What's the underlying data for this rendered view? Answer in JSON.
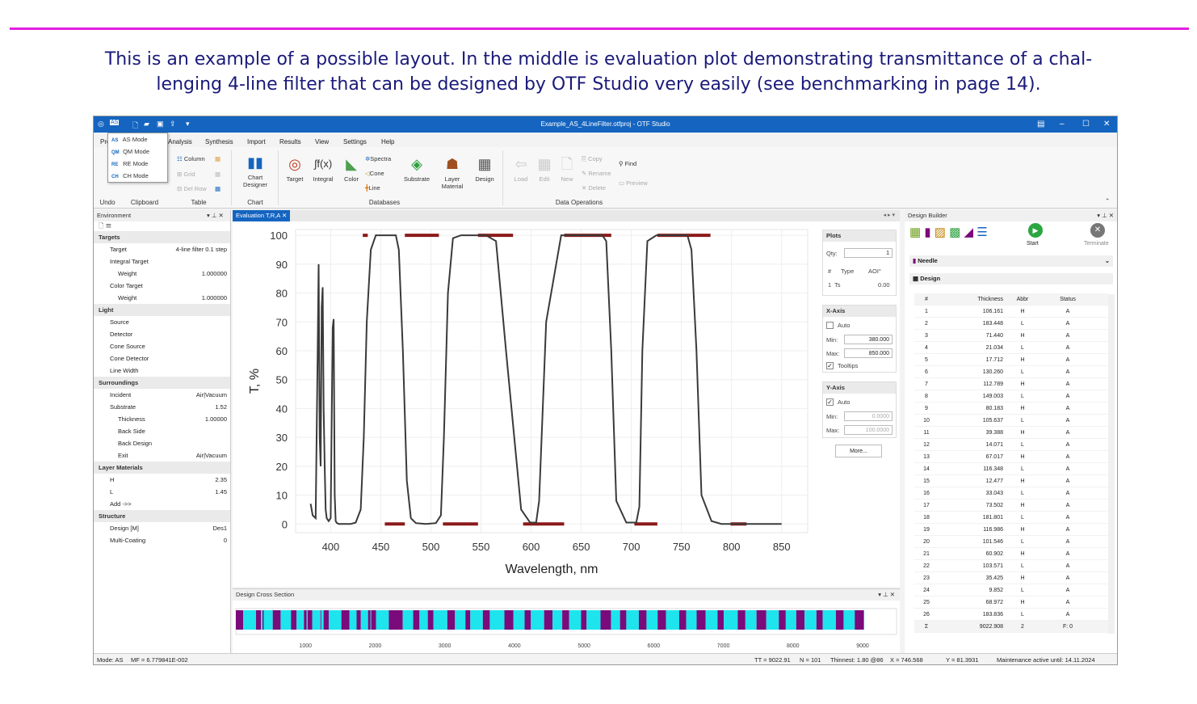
{
  "caption": {
    "line1": "This is an example of a possible layout. In the middle is evaluation plot demonstrating transmittance of a chal-",
    "line2": "lenging 4-line filter that can be designed by OTF Studio very easily (see benchmarking in page 14)."
  },
  "window": {
    "title": "Example_AS_4LineFilter.otfproj - OTF Studio",
    "mode_badge": "AS"
  },
  "menu": [
    "Pro",
    "Analysis",
    "Synthesis",
    "Import",
    "Results",
    "View",
    "Settings",
    "Help"
  ],
  "mode_menu": [
    {
      "code": "AS",
      "label": "AS Mode"
    },
    {
      "code": "QM",
      "label": "QM Mode"
    },
    {
      "code": "RE",
      "label": "RE Mode"
    },
    {
      "code": "CH",
      "label": "CH Mode"
    }
  ],
  "ribbon": {
    "table_items": [
      "Column",
      "Grid",
      "Del Row"
    ],
    "chart_designer": "Chart Designer",
    "db_buttons": [
      "Target",
      "Integral",
      "Color"
    ],
    "db_small": [
      "Spectra",
      "Cone",
      "Line"
    ],
    "substrate": "Substrate",
    "layer_material": "Layer Material",
    "design": "Design",
    "dataops": [
      "Load",
      "Edit",
      "New"
    ],
    "dataops_small": [
      "Copy",
      "Rename",
      "Delete"
    ],
    "find": "Find",
    "preview": "Preview",
    "groups": [
      "Undo",
      "Clipboard",
      "Table",
      "Chart",
      "Databases",
      "Data Operations"
    ]
  },
  "env": {
    "title": "Environment",
    "rows": [
      {
        "t": "cat",
        "label": "Targets"
      },
      {
        "t": "in1",
        "label": "Target",
        "value": "4-line filter 0.1 step"
      },
      {
        "t": "in1",
        "label": "Integral Target",
        "value": ""
      },
      {
        "t": "in2",
        "label": "Weight",
        "value": "1.000000"
      },
      {
        "t": "in1",
        "label": "Color Target",
        "value": ""
      },
      {
        "t": "in2",
        "label": "Weight",
        "value": "1.000000"
      },
      {
        "t": "cat",
        "label": "Light"
      },
      {
        "t": "in1",
        "label": "Source",
        "value": ""
      },
      {
        "t": "in1",
        "label": "Detector",
        "value": ""
      },
      {
        "t": "in1",
        "label": "Cone Source",
        "value": ""
      },
      {
        "t": "in1",
        "label": "Cone Detector",
        "value": ""
      },
      {
        "t": "in1",
        "label": "Line Width",
        "value": ""
      },
      {
        "t": "cat",
        "label": "Surroundings"
      },
      {
        "t": "in1",
        "label": "Incident",
        "value": "Air|Vacuum"
      },
      {
        "t": "in1",
        "label": "Substrate",
        "value": "1.52"
      },
      {
        "t": "in2",
        "label": "Thickness",
        "value": "1.00000"
      },
      {
        "t": "in2",
        "label": "Back Side",
        "value": ""
      },
      {
        "t": "in2",
        "label": "Back Design",
        "value": ""
      },
      {
        "t": "in2",
        "label": "Exit",
        "value": "Air|Vacuum"
      },
      {
        "t": "cat",
        "label": "Layer Materials"
      },
      {
        "t": "in1",
        "label": "H",
        "value": "2.35"
      },
      {
        "t": "in1",
        "label": "L",
        "value": "1.45"
      },
      {
        "t": "in1",
        "label": "Add ->>",
        "value": ""
      },
      {
        "t": "cat",
        "label": "Structure"
      },
      {
        "t": "in1",
        "label": "Design [M]",
        "value": "Des1"
      },
      {
        "t": "in1",
        "label": "Multi-Coating",
        "value": "0"
      }
    ]
  },
  "plot_tab": "Evaluation T,R,A",
  "chart_data": {
    "type": "line",
    "xlabel": "Wavelength, nm",
    "ylabel": "T, %",
    "xticks": [
      400,
      450,
      500,
      550,
      600,
      650,
      700,
      750,
      800,
      850
    ],
    "yticks": [
      0,
      10,
      20,
      30,
      40,
      50,
      60,
      70,
      80,
      90,
      100
    ],
    "xlim": [
      365,
      876
    ],
    "ylim": [
      -3,
      102
    ],
    "series": [
      {
        "x": [
          380,
          382,
          385,
          387,
          388,
          389,
          390,
          391,
          392,
          393,
          394,
          395,
          396,
          398,
          400,
          402,
          403,
          404,
          405,
          406,
          408,
          410,
          412,
          420,
          425,
          430,
          433,
          436,
          440,
          445,
          450,
          455,
          460,
          465,
          468,
          472,
          476,
          480,
          485,
          495,
          505,
          510,
          513,
          517,
          522,
          530,
          535,
          540,
          545,
          555,
          565,
          575,
          590,
          599,
          602,
          605,
          608,
          615,
          630,
          655,
          668,
          671,
          675,
          680,
          685,
          695,
          705,
          708,
          711,
          716,
          725,
          740,
          752,
          756,
          760,
          765,
          770,
          780,
          790,
          800,
          820,
          850
        ],
        "y": [
          7,
          3,
          2,
          60,
          90,
          30,
          20,
          75,
          82,
          40,
          20,
          5,
          2,
          1,
          2,
          68,
          71,
          10,
          1,
          0.4,
          0,
          0,
          0,
          0,
          0.5,
          5,
          30,
          70,
          95,
          100,
          100,
          100,
          100,
          100,
          95,
          60,
          15,
          2,
          0.3,
          0,
          0.3,
          3,
          30,
          80,
          99,
          100,
          100,
          100,
          100,
          100,
          98,
          60,
          5,
          0.5,
          0.5,
          0.5,
          8,
          70,
          100,
          100,
          100,
          100,
          98,
          60,
          8,
          0.5,
          0.5,
          6,
          60,
          98,
          100,
          100,
          100,
          100,
          95,
          60,
          10,
          1,
          0,
          0,
          0,
          0
        ]
      }
    ],
    "targets": [
      [
        432,
        437,
        100
      ],
      [
        454,
        474,
        0
      ],
      [
        474,
        508,
        100
      ],
      [
        512,
        547,
        0
      ],
      [
        547,
        582,
        100
      ],
      [
        592,
        633,
        0
      ],
      [
        633,
        680,
        100
      ],
      [
        703,
        726,
        0
      ],
      [
        726,
        779,
        100
      ],
      [
        799,
        815,
        0
      ]
    ]
  },
  "props": {
    "plots": "Plots",
    "qty_label": "Qty:",
    "qty": "1",
    "col_num": "#",
    "col_type": "Type",
    "col_aoi": "AOI°",
    "row_num": "1",
    "row_type": "Ts",
    "row_aoi": "0.00",
    "xaxis": "X-Axis",
    "auto": "Auto",
    "min_label": "Min:",
    "max_label": "Max:",
    "xmin": "380.000",
    "xmax": "850.000",
    "tooltips": "Tooltips",
    "yaxis": "Y-Axis",
    "ymin": "0.0000",
    "ymax": "100.0000",
    "more": "More..."
  },
  "cross": {
    "title": "Design Cross Section",
    "ticks": [
      1000,
      2000,
      3000,
      4000,
      5000,
      6000,
      7000,
      8000,
      9000
    ],
    "total": 9022.908,
    "layers": [
      106.161,
      183.448,
      71.44,
      21.034,
      17.712,
      130.26,
      112.789,
      149.003,
      80.183,
      105.637,
      39.388,
      14.071,
      67.017,
      116.348,
      12.477,
      33.043,
      73.502,
      181.801,
      116.986,
      101.546,
      60.902,
      103.571,
      35.425,
      9.852,
      68.972,
      183.836,
      200,
      150,
      90,
      120,
      80,
      200,
      110,
      150,
      70,
      180,
      100,
      210,
      130,
      160,
      90,
      190,
      120,
      140,
      100,
      170,
      80,
      200,
      150,
      130,
      90,
      180,
      110,
      160,
      120,
      190,
      100,
      150,
      130,
      170,
      90,
      200,
      110,
      160,
      140,
      180,
      100,
      150,
      120,
      170,
      90,
      190,
      110,
      160,
      130,
      180,
      100,
      150,
      120,
      170,
      90,
      200,
      110,
      160,
      140,
      180,
      100,
      150,
      120,
      170,
      90,
      190,
      110,
      160,
      130,
      180,
      100,
      120
    ]
  },
  "designbuilder": {
    "title": "Design Builder",
    "start": "Start",
    "terminate": "Terminate",
    "needle": "Needle",
    "design": "Design",
    "headers": [
      "#",
      "Thickness",
      "Abbr",
      "Status"
    ],
    "rows": [
      [
        "1",
        "106.161",
        "H",
        "A"
      ],
      [
        "2",
        "183.448",
        "L",
        "A"
      ],
      [
        "3",
        "71.440",
        "H",
        "A"
      ],
      [
        "4",
        "21.034",
        "L",
        "A"
      ],
      [
        "5",
        "17.712",
        "H",
        "A"
      ],
      [
        "6",
        "130.260",
        "L",
        "A"
      ],
      [
        "7",
        "112.789",
        "H",
        "A"
      ],
      [
        "8",
        "149.003",
        "L",
        "A"
      ],
      [
        "9",
        "80.183",
        "H",
        "A"
      ],
      [
        "10",
        "105.637",
        "L",
        "A"
      ],
      [
        "11",
        "39.388",
        "H",
        "A"
      ],
      [
        "12",
        "14.071",
        "L",
        "A"
      ],
      [
        "13",
        "67.017",
        "H",
        "A"
      ],
      [
        "14",
        "116.348",
        "L",
        "A"
      ],
      [
        "15",
        "12.477",
        "H",
        "A"
      ],
      [
        "16",
        "33.043",
        "L",
        "A"
      ],
      [
        "17",
        "73.502",
        "H",
        "A"
      ],
      [
        "18",
        "181.801",
        "L",
        "A"
      ],
      [
        "19",
        "116.986",
        "H",
        "A"
      ],
      [
        "20",
        "101.546",
        "L",
        "A"
      ],
      [
        "21",
        "60.902",
        "H",
        "A"
      ],
      [
        "22",
        "103.571",
        "L",
        "A"
      ],
      [
        "23",
        "35.425",
        "H",
        "A"
      ],
      [
        "24",
        "9.852",
        "L",
        "A"
      ],
      [
        "25",
        "68.972",
        "H",
        "A"
      ],
      [
        "26",
        "183.836",
        "L",
        "A"
      ]
    ],
    "sum": [
      "Σ",
      "9022.908",
      "2",
      "F: 0"
    ]
  },
  "status": {
    "mode": "Mode: AS",
    "mf": "MF = 6.779841E-002",
    "tt": "TT = 9022.91",
    "n": "N = 101",
    "thinnest": "Thinnest:   1.80 @86",
    "x": "X = 746.568",
    "y": "Y = 81.3931",
    "maint": "Maintenance active until: 14.11.2024"
  },
  "colors": {
    "accent": "#1565c0",
    "H": "#7b0a7a",
    "L": "#1ee4ee",
    "target": "#8b1a1a",
    "curve": "#3a3a3a"
  }
}
